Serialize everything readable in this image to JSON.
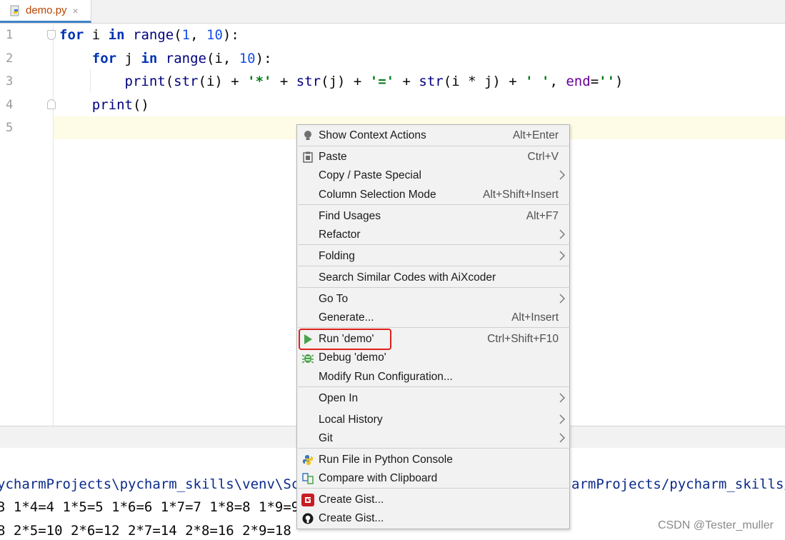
{
  "tab": {
    "filename": "demo.py",
    "close_glyph": "×",
    "icon": "python-file-icon"
  },
  "editor": {
    "line_numbers": [
      "1",
      "2",
      "3",
      "4",
      "5"
    ],
    "lines": [
      [
        [
          "kw",
          "for"
        ],
        [
          "t",
          " i "
        ],
        [
          "kw",
          "in"
        ],
        [
          "t",
          " "
        ],
        [
          "bi",
          "range"
        ],
        [
          "t",
          "("
        ],
        [
          "num",
          "1"
        ],
        [
          "t",
          ", "
        ],
        [
          "num",
          "10"
        ],
        [
          "t",
          "):"
        ]
      ],
      [
        [
          "t",
          "    "
        ],
        [
          "kw",
          "for"
        ],
        [
          "t",
          " j "
        ],
        [
          "kw",
          "in"
        ],
        [
          "t",
          " "
        ],
        [
          "bi",
          "range"
        ],
        [
          "t",
          "(i, "
        ],
        [
          "num",
          "10"
        ],
        [
          "t",
          "):"
        ]
      ],
      [
        [
          "t",
          "        "
        ],
        [
          "bi",
          "print"
        ],
        [
          "t",
          "("
        ],
        [
          "bi",
          "str"
        ],
        [
          "t",
          "(i) + "
        ],
        [
          "str",
          "'*'"
        ],
        [
          "t",
          " + "
        ],
        [
          "bi",
          "str"
        ],
        [
          "t",
          "(j) + "
        ],
        [
          "str",
          "'='"
        ],
        [
          "t",
          " + "
        ],
        [
          "bi",
          "str"
        ],
        [
          "t",
          "(i * j) + "
        ],
        [
          "str",
          "' '"
        ],
        [
          "t",
          ", "
        ],
        [
          "kwarg",
          "end"
        ],
        [
          "t",
          "="
        ],
        [
          "str",
          "''"
        ],
        [
          "t",
          ")"
        ]
      ],
      [
        [
          "t",
          "    "
        ],
        [
          "bi",
          "print"
        ],
        [
          "t",
          "()"
        ]
      ],
      []
    ]
  },
  "console": {
    "lines": [
      "ycharmProjects\\pycharm_skills\\venv\\Scr",
      "3 1*4=4 1*5=5 1*6=6 1*7=7 1*8=8 1*9=9",
      "8 2*5=10 2*6=12 2*7=14 2*8=16 2*9=18"
    ],
    "right_text": "armProjects/pycharm_skills/c"
  },
  "watermark": "CSDN @Tester_muller",
  "menu": {
    "items": [
      {
        "label": "Show Context Actions",
        "shortcut": "Alt+Enter",
        "icon": "lightbulb-icon"
      },
      {
        "label": "Paste",
        "shortcut": "Ctrl+V",
        "icon": "clipboard-icon"
      },
      {
        "label": "Copy / Paste Special",
        "submenu": true
      },
      {
        "label": "Column Selection Mode",
        "shortcut": "Alt+Shift+Insert"
      },
      {
        "label": "Find Usages",
        "shortcut": "Alt+F7"
      },
      {
        "label": "Refactor",
        "submenu": true
      },
      {
        "label": "Folding",
        "submenu": true
      },
      {
        "label": "Search Similar Codes with AiXcoder"
      },
      {
        "label": "Go To",
        "submenu": true
      },
      {
        "label": "Generate...",
        "shortcut": "Alt+Insert"
      },
      {
        "label": "Run 'demo'",
        "shortcut": "Ctrl+Shift+F10",
        "icon": "run-icon",
        "highlighted": true
      },
      {
        "label": "Debug 'demo'",
        "icon": "debug-icon"
      },
      {
        "label": "Modify Run Configuration..."
      },
      {
        "label": "Open In",
        "submenu": true
      },
      {
        "label": "Local History",
        "submenu": true
      },
      {
        "label": "Git",
        "submenu": true
      },
      {
        "label": "Run File in Python Console",
        "icon": "python-console-icon"
      },
      {
        "label": "Compare with Clipboard",
        "icon": "compare-icon"
      },
      {
        "label": "Create Gist...",
        "icon": "gitee-icon"
      },
      {
        "label": "Create Gist...",
        "icon": "github-icon"
      }
    ]
  },
  "colors": {
    "accent": "#4083c9",
    "highlight_border": "#e0201c",
    "run_green": "#4aa34a"
  }
}
